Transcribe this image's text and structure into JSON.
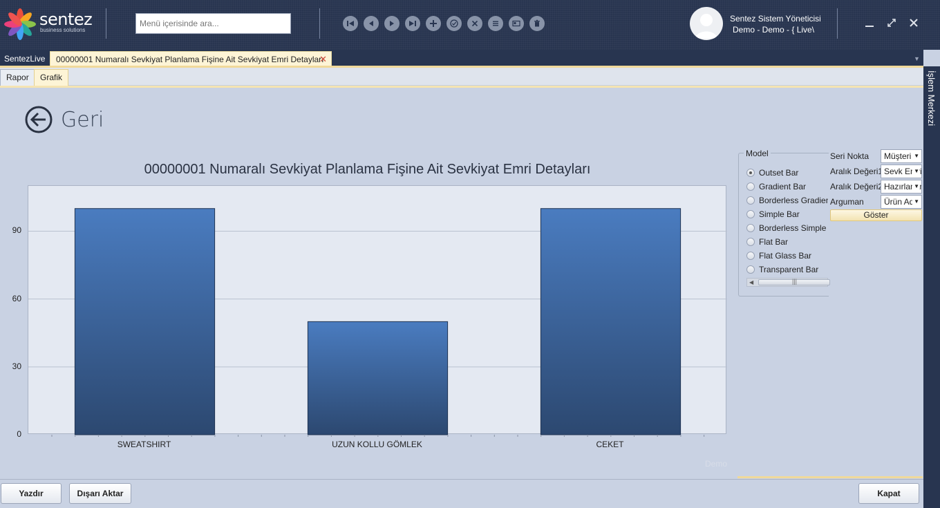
{
  "header": {
    "logo_text": "sentez",
    "logo_sub": "business solutions",
    "search_placeholder": "Menü içerisinde ara...",
    "user_name": "Sentez Sistem Yöneticisi",
    "user_sub": "Demo - Demo - { Live\\"
  },
  "nav_icons": [
    "first-icon",
    "prev-icon",
    "play-icon",
    "last-icon",
    "add-icon",
    "check-icon",
    "cancel-icon",
    "list-icon",
    "card-icon",
    "delete-icon"
  ],
  "tabs": {
    "home": "SentezLive",
    "doc": "00000001 Numaralı Sevkiyat Planlama Fişine Ait Sevkiyat Emri Detayları",
    "close": "✕"
  },
  "side_panel_label": "İşlem Merkezi",
  "subtabs": {
    "rapor": "Rapor",
    "grafik": "Grafik"
  },
  "back_label": "Geri",
  "model": {
    "legend": "Model",
    "options": [
      "Outset Bar",
      "Gradient Bar",
      "Borderless Gradient Bar",
      "Simple Bar",
      "Borderless Simple Bar",
      "Flat Bar",
      "Flat Glass Bar",
      "Transparent Bar"
    ],
    "selected": "Outset Bar"
  },
  "params": {
    "seri_label": "Seri Nokta",
    "seri_value": "Müşteri",
    "aralik1_label": "Aralık Değeri1",
    "aralik1_value": "Sevk Emri",
    "aralik2_label": "Aralık Değeri2",
    "aralik2_value": "Hazırlanan",
    "arguman_label": "Arguman",
    "arguman_value": "Ürün Adı",
    "goster": "Göster"
  },
  "watermark": "Demo",
  "buttons": {
    "yazdir": "Yazdır",
    "disari": "Dışarı Aktar",
    "kapat": "Kapat"
  },
  "colors": {
    "header": "#283550",
    "bar_top": "#4a7cc0",
    "bar_bottom": "#2c4870",
    "accent": "#f0d99a"
  },
  "chart_data": {
    "type": "bar",
    "title": "00000001 Numaralı Sevkiyat Planlama Fişine Ait Sevkiyat Emri Detayları",
    "categories": [
      "SWEATSHIRT",
      "UZUN KOLLU GÖMLEK",
      "CEKET"
    ],
    "values": [
      100,
      50,
      100
    ],
    "yticks": [
      0,
      30,
      60,
      90
    ],
    "ylim": [
      0,
      110
    ],
    "grid": true,
    "legend": "none"
  }
}
